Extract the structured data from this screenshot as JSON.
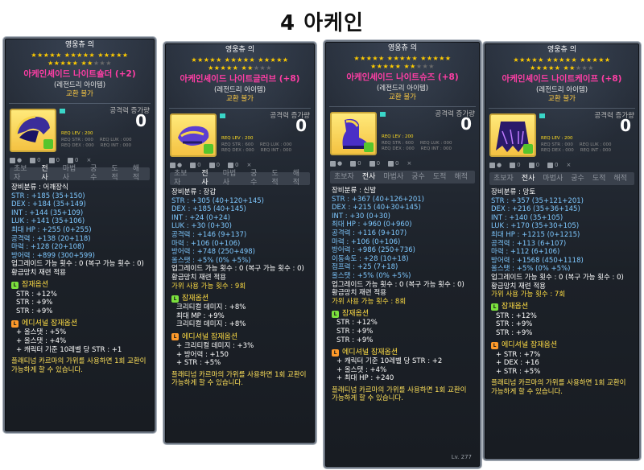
{
  "page": {
    "title": "4 아케인"
  },
  "panels": [
    {
      "owner": "영웅츄 의",
      "name": "아케인셰이드 나이트숄더 (+2)",
      "grade": "(레전드리 아이템)",
      "trade": "교환 불가",
      "atk_label": "공격력 증가량",
      "atk_value": "0",
      "req_lev": "REQ LEV : 200",
      "req_str": "REQ STR : 000",
      "req_dex": "REQ DEX : 000",
      "req_luk": "REQ LUK : 000",
      "req_int": "REQ INT : 000",
      "slots": "∑ ?",
      "classes": [
        "초보자",
        "전사",
        "마법사",
        "궁수",
        "도적",
        "해적"
      ],
      "active_class": 1,
      "stats": [
        {
          "t": "장비분류 : 어깨장식",
          "c": "white"
        },
        {
          "t": "STR : +185 (35+150)",
          "c": "blue"
        },
        {
          "t": "DEX : +184 (35+149)",
          "c": "blue"
        },
        {
          "t": "INT : +144 (35+109)",
          "c": "blue"
        },
        {
          "t": "LUK : +141 (35+106)",
          "c": "blue"
        },
        {
          "t": "최대 HP : +255 (0+255)",
          "c": "blue"
        },
        {
          "t": "공격력 : +138 (20+118)",
          "c": "blue"
        },
        {
          "t": "마력 : +128 (20+108)",
          "c": "blue"
        },
        {
          "t": "방어력 : +899 (300+599)",
          "c": "blue"
        },
        {
          "t": "업그레이드 가능 횟수 : 0 (복구 가능 횟수 : 0)",
          "c": "white"
        },
        {
          "t": "황금망치 재련 적용",
          "c": "white"
        }
      ],
      "potential_title": "잠재옵션",
      "potential": [
        "STR : +12%",
        "STR : +9%",
        "STR : +9%"
      ],
      "additional_title": "에디셔널 잠재옵션",
      "additional": [
        "+ 올스탯 : +5%",
        "+ 올스탯 : +4%",
        "+ 캐릭터 기준 10레벨 당 STR : +1"
      ],
      "footer": "플래티넘 카르마의 가위를 사용하면 1회 교환이 가능하게 할 수 있습니다."
    },
    {
      "owner": "영웅츄 의",
      "name": "아케인셰이드 나이트글러브 (+8)",
      "grade": "(레전드리 아이템)",
      "trade": "교환 불가",
      "atk_label": "공격력 증가량",
      "atk_value": "0",
      "req_lev": "REQ LEV : 200",
      "req_str": "REQ STR : 600",
      "req_dex": "REQ DEX : 000",
      "req_luk": "REQ LUK : 000",
      "req_int": "REQ INT : 000",
      "classes": [
        "초보자",
        "전사",
        "마법사",
        "궁수",
        "도적",
        "해적"
      ],
      "active_class": 1,
      "stats": [
        {
          "t": "장비분류 : 장갑",
          "c": "white"
        },
        {
          "t": "STR : +305 (40+120+145)",
          "c": "blue"
        },
        {
          "t": "DEX : +185 (40+145)",
          "c": "blue"
        },
        {
          "t": "INT : +24 (0+24)",
          "c": "blue"
        },
        {
          "t": "LUK : +30 (0+30)",
          "c": "blue"
        },
        {
          "t": "공격력 : +146 (9+137)",
          "c": "blue"
        },
        {
          "t": "마력 : +106 (0+106)",
          "c": "blue"
        },
        {
          "t": "방어력 : +748 (250+498)",
          "c": "blue"
        },
        {
          "t": "올스탯 : +5% (0% +5%)",
          "c": "blue"
        },
        {
          "t": "업그레이드 가능 횟수 : 0 (복구 가능 횟수 : 0)",
          "c": "white"
        },
        {
          "t": "황금망치 재련 적용",
          "c": "white"
        },
        {
          "t": "가위 사용 가능 횟수 : 9회",
          "c": "yellow"
        }
      ],
      "potential_title": "잠재옵션",
      "potential": [
        "크리티컬 데미지 : +8%",
        "최대 MP : +9%",
        "크리티컬 데미지 : +8%"
      ],
      "additional_title": "에디셔널 잠재옵션",
      "additional": [
        "+ 크리티컬 데미지 : +3%",
        "+ 방어력 : +150",
        "+ STR : +5%"
      ],
      "footer": "플래티넘 카르마의 가위를 사용하면 1회 교환이 가능하게 할 수 있습니다."
    },
    {
      "owner": "영웅츄 의",
      "name": "아케인셰이드 나이트슈즈 (+8)",
      "grade": "(레전드리 아이템)",
      "trade": "교환 불가",
      "atk_label": "공격력 증가량",
      "atk_value": "0",
      "req_lev": "REQ LEV : 200",
      "req_str": "REQ STR : 600",
      "req_dex": "REQ DEX : 000",
      "req_luk": "REQ LUK : 000",
      "req_int": "REQ INT : 000",
      "classes": [
        "초보자",
        "전사",
        "마법사",
        "궁수",
        "도적",
        "해적"
      ],
      "active_class": 1,
      "stats": [
        {
          "t": "장비분류 : 신발",
          "c": "white"
        },
        {
          "t": "STR : +367 (40+126+201)",
          "c": "blue"
        },
        {
          "t": "DEX : +215 (40+30+145)",
          "c": "blue"
        },
        {
          "t": "INT : +30 (0+30)",
          "c": "blue"
        },
        {
          "t": "최대 HP : +960 (0+960)",
          "c": "blue"
        },
        {
          "t": "공격력 : +116 (9+107)",
          "c": "blue"
        },
        {
          "t": "마력 : +106 (0+106)",
          "c": "blue"
        },
        {
          "t": "방어력 : +986 (250+736)",
          "c": "blue"
        },
        {
          "t": "이동속도 : +28 (10+18)",
          "c": "blue"
        },
        {
          "t": "점프력 : +25 (7+18)",
          "c": "blue"
        },
        {
          "t": "올스탯 : +5% (0% +5%)",
          "c": "blue"
        },
        {
          "t": "업그레이드 가능 횟수 : 0 (복구 가능 횟수 : 0)",
          "c": "white"
        },
        {
          "t": "황금망치 재련 적용",
          "c": "white"
        },
        {
          "t": "가위 사용 가능 횟수 : 8회",
          "c": "yellow"
        }
      ],
      "potential_title": "잠재옵션",
      "potential": [
        "STR : +12%",
        "STR : +9%",
        "STR : +9%"
      ],
      "additional_title": "에디셔널 잠재옵션",
      "additional": [
        "+ 캐릭터 기준 10레벨 당 STR : +2",
        "+ 올스탯 : +4%",
        "+ 최대 HP : +240"
      ],
      "footer": "플래티넘 카르마의 가위를 사용하면 1회 교환이 가능하게 할 수 있습니다.",
      "level_tag": "Lv. 277"
    },
    {
      "owner": "영웅츄 의",
      "name": "아케인셰이드 나이트케이프 (+8)",
      "grade": "(레전드리 아이템)",
      "trade": "교환 불가",
      "atk_label": "공격력 증가량",
      "atk_value": "0",
      "req_lev": "REQ LEV : 200",
      "req_str": "REQ STR : 000",
      "req_dex": "REQ DEX : 000",
      "req_luk": "REQ LUK : 000",
      "req_int": "REQ INT : 000",
      "classes": [
        "초보자",
        "전사",
        "마법사",
        "궁수",
        "도적",
        "해적"
      ],
      "active_class": 1,
      "stats": [
        {
          "t": "장비분류 : 망토",
          "c": "white"
        },
        {
          "t": "STR : +357 (35+121+201)",
          "c": "blue"
        },
        {
          "t": "DEX : +216 (35+36+145)",
          "c": "blue"
        },
        {
          "t": "INT : +140 (35+105)",
          "c": "blue"
        },
        {
          "t": "LUK : +170 (35+30+105)",
          "c": "blue"
        },
        {
          "t": "최대 HP : +1215 (0+1215)",
          "c": "blue"
        },
        {
          "t": "공격력 : +113 (6+107)",
          "c": "blue"
        },
        {
          "t": "마력 : +112 (6+106)",
          "c": "blue"
        },
        {
          "t": "방어력 : +1568 (450+1118)",
          "c": "blue"
        },
        {
          "t": "올스탯 : +5% (0% +5%)",
          "c": "blue"
        },
        {
          "t": "업그레이드 가능 횟수 : 0 (복구 가능 횟수 : 0)",
          "c": "white"
        },
        {
          "t": "황금망치 재련 적용",
          "c": "white"
        },
        {
          "t": "가위 사용 가능 횟수 : 7회",
          "c": "yellow"
        }
      ],
      "potential_title": "잠재옵션",
      "potential": [
        "STR : +12%",
        "STR : +9%",
        "STR : +9%"
      ],
      "additional_title": "에디셔널 잠재옵션",
      "additional": [
        "+ STR : +7%",
        "+ DEX : +16",
        "+ STR : +5%"
      ],
      "footer": "플래티넘 카르마의 가위를 사용하면 1회 교환이 가능하게 할 수 있습니다."
    }
  ],
  "colors": {
    "item_name": "#ff3ea5",
    "stat_blue": "#7ec8ff",
    "star_gold": "#ffcc00",
    "footer_yellow": "#ffe15a",
    "icon_box": "#f4c242",
    "lock_green": "#56c52d"
  },
  "icons": [
    "shoulder-item-icon",
    "glove-item-icon",
    "shoes-item-icon",
    "cape-item-icon",
    "padlock-icon"
  ]
}
